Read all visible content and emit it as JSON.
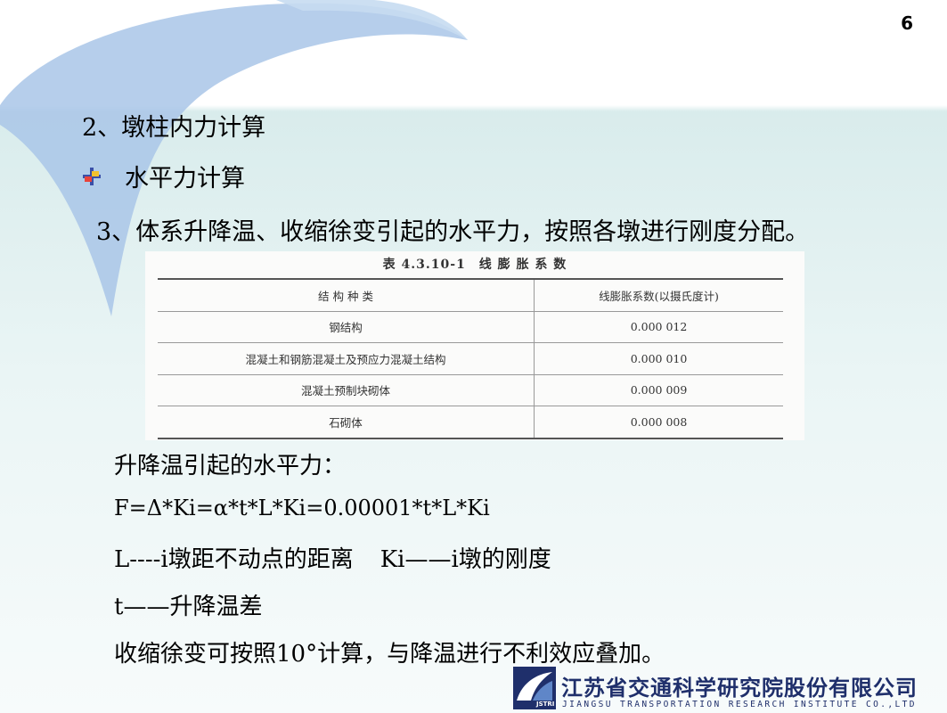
{
  "page_number": "6",
  "section_title": "2、墩柱内力计算",
  "bullet_text": "水平力计算",
  "point_text": "3、体系升降温、收缩徐变引起的水平力，按照各墩进行刚度分配。",
  "table": {
    "caption": "表 4.3.10-1　线 膨 胀 系 数",
    "headers": [
      "结 构 种 类",
      "线膨胀系数(以摄氏度计)"
    ],
    "rows": [
      [
        "钢结构",
        "0.000 012"
      ],
      [
        "混凝土和钢筋混凝土及预应力混凝土结构",
        "0.000 010"
      ],
      [
        "混凝土预制块砌体",
        "0.000 009"
      ],
      [
        "石砌体",
        "0.000 008"
      ]
    ]
  },
  "heat_title": "升降温引起的水平力：",
  "formula": "F=Δ*Ki=α*t*L*Ki=0.00001*t*L*Ki",
  "def_L": "L----i墩距不动点的距离",
  "def_Ki": "Ki——i墩的刚度",
  "def_t": "t——升降温差",
  "shrink_text": "收缩徐变可按照10°计算，与降温进行不利效应叠加。",
  "footer": {
    "logo_text": "JSTRI",
    "company_cn": "江苏省交通科学研究院股份有限公司",
    "company_en": "JIANGSU TRANSPORTATION RESEARCH INSTITUTE CO.,LTD"
  },
  "colors": {
    "accent_blue": "#a9c6e8",
    "brand_navy": "#1f2f6b",
    "band": "#d9ecec"
  },
  "icons": {
    "bullet": "cross-bullet-icon"
  }
}
